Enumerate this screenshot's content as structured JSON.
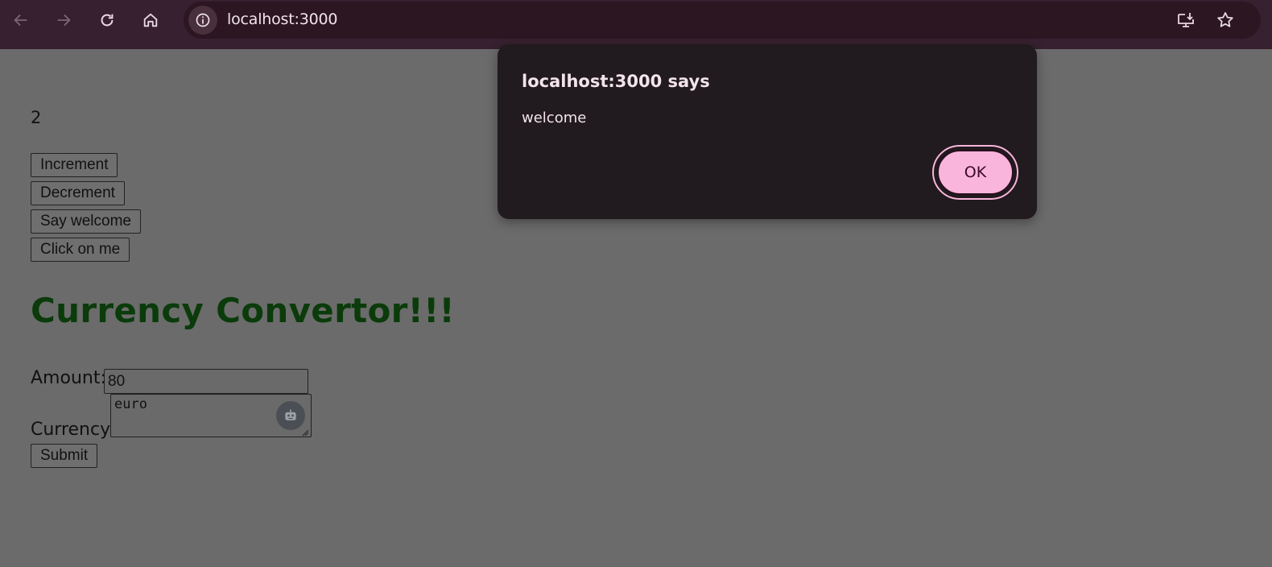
{
  "browser": {
    "url": "localhost:3000",
    "icons": {
      "back": "arrow-left-icon",
      "forward": "arrow-right-icon",
      "reload": "reload-icon",
      "home": "home-icon",
      "site_info": "info-icon",
      "install": "install-app-icon",
      "bookmark": "star-icon"
    },
    "colors": {
      "toolbar": "#37202f",
      "omnibox": "#2b1622"
    }
  },
  "page": {
    "count": "2",
    "buttons": {
      "increment": "Increment",
      "decrement": "Decrement",
      "say_welcome": "Say welcome",
      "click_on_me": "Click on me"
    },
    "heading": "Currency Convertor!!!",
    "form": {
      "amount_label": "Amount:",
      "amount_value": "80",
      "currency_label": "Currency:",
      "currency_value": "euro",
      "submit_label": "Submit"
    },
    "colors": {
      "heading": "#0b3b0b",
      "overlay_background": "#6b6b6b"
    }
  },
  "dialog": {
    "title": "localhost:3000 says",
    "message": "welcome",
    "ok_label": "OK",
    "colors": {
      "background": "#211a1e",
      "ok_button": "#f9b5dc"
    }
  }
}
